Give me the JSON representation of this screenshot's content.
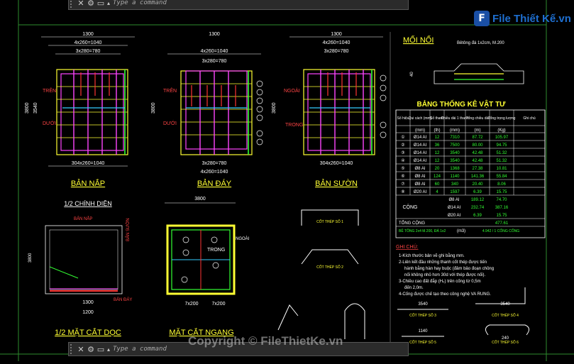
{
  "command_line": {
    "prompt": "Type a command",
    "close_icon": "close-icon",
    "settings_icon": "wrench-icon",
    "prompt_icon": "command-prompt-icon"
  },
  "watermark": "Copyright © FileThietKe.vn",
  "logo": {
    "mark": "F",
    "text": "File Thiết Kế.vn"
  },
  "colors": {
    "background": "#000000",
    "accent": "#1e6fd0",
    "title": "#ffff33"
  },
  "drawings": {
    "nap": {
      "title": "BẢN NẮP",
      "total": "1300",
      "top1": "4x260=1040",
      "top2": "3x280=780",
      "bot1": "304x260=1040",
      "side": "100",
      "h1": "3800",
      "h2": "3540",
      "tren": "TRÊN",
      "duoi": "DƯỚI"
    },
    "day": {
      "title": "BẢN ĐÁY",
      "total": "1300",
      "top1": "4x260=1040",
      "top2": "3x280=780",
      "bot1": "3x280=780",
      "bot2": "4x260=1040",
      "h1": "3800",
      "h2": "3540",
      "tren": "TRÊN",
      "duoi": "DƯỚI"
    },
    "suon": {
      "title": "BẢN SƯỜN",
      "total": "1300",
      "top1": "4x260=1040",
      "top2": "3x280=780",
      "bot1": "304x260=1040",
      "h1": "3800",
      "h2": "3540",
      "ngoai": "NGOÀI",
      "trong": "TRONG"
    },
    "chinh_dien": {
      "title": "1/2 CHÍNH DIỆN",
      "ban_nap": "BẢN NẮP",
      "ban_suon": "BẢN SƯỜN",
      "ban_day": "BẢN ĐÁY",
      "w": "1300",
      "w2": "1200"
    },
    "cat_doc": {
      "title": "1/2 MẶT CẮT DỌC"
    },
    "cat_ngang": {
      "title": "MẶT CẮT NGANG",
      "top": "3800",
      "bot1": "7x200",
      "bot2": "7x200",
      "trong": "TRONG",
      "ngoai": "NGOÀI"
    }
  },
  "moi_noi": {
    "title": "MỐI NỐI",
    "note": "Bêtông đá 1x2cm, M.200"
  },
  "table": {
    "title": "BẢNG THỐNG KÊ VẬT TƯ",
    "headers": [
      "Số hiệu",
      "Qui cách (mm)",
      "Số thanh",
      "Chiều dài 1 thanh",
      "Tổng chiều dài",
      "Tổng trọng lượng",
      "Ghi chú"
    ],
    "units": [
      "",
      "(mm)",
      "(th)",
      "(mm)",
      "(m)",
      "(Kg)",
      ""
    ],
    "rows": [
      [
        "①",
        "Ø14 AI",
        "12",
        "7310",
        "87.72",
        "105.97"
      ],
      [
        "②",
        "Ø14 AI",
        "36",
        "7500",
        "80.00",
        "94.75"
      ],
      [
        "③",
        "Ø14 AI",
        "12",
        "3540",
        "42.48",
        "51.32"
      ],
      [
        "④",
        "Ø14 AI",
        "12",
        "3540",
        "42.48",
        "51.32"
      ],
      [
        "⑤",
        "Ø8 AI",
        "20",
        "1368",
        "27.38",
        "10.81"
      ],
      [
        "⑥",
        "Ø8 AI",
        "124",
        "1140",
        "141.36",
        "55.84"
      ],
      [
        "⑦",
        "Ø8 AI",
        "60",
        "340",
        "20.40",
        "8.06"
      ],
      [
        "⑧",
        "Ø20 AI",
        "4",
        "1597",
        "6.39",
        "15.75"
      ]
    ],
    "cong_label": "CỘNG",
    "cong_rows": [
      [
        "Ø8 AI",
        "189.12",
        "74.70"
      ],
      [
        "Ø14 AI",
        "232.74",
        "387.16"
      ],
      [
        "Ø20 AI",
        "6.39",
        "15.75"
      ]
    ],
    "tong_cong": "TỔNG CỘNG",
    "tong_value": "477.61",
    "betong_label": "BÊ TÔNG 2x4 M.200, ĐÁ 1x2",
    "betong_unit": "(m3)",
    "betong_value": "4.942 / 1 CỐNG CỐNG"
  },
  "notes": {
    "title": "GHI CHÚ:",
    "lines": [
      "1-Kích thước bản vẽ ghi bằng mm.",
      "2-Liên kết đầu những thanh cốt thép được tiến",
      "hành bằng hàn hay buộc (đảm bảo đoạn chồng",
      "nối không nhỏ hơn 30d với thép được nối).",
      "3-Chiều cao đất đắp (H₀) trên cống từ 0,5m",
      "đến 2,0m.",
      "4-Cống được chế tạo theo công nghệ VA RUNG."
    ]
  },
  "bars": {
    "b1": "CỐT THÉP SỐ 1",
    "b2": "CỐT THÉP SỐ 2",
    "b3": "CỐT THÉP SỐ 3",
    "b4": "CỐT THÉP SỐ 4",
    "b5": "CỐT THÉP SỐ 5",
    "b6": "CỐT THÉP SỐ 6",
    "len1": "3540",
    "len2": "3540",
    "len3": "1140",
    "len4": "1140",
    "len5": "240"
  }
}
